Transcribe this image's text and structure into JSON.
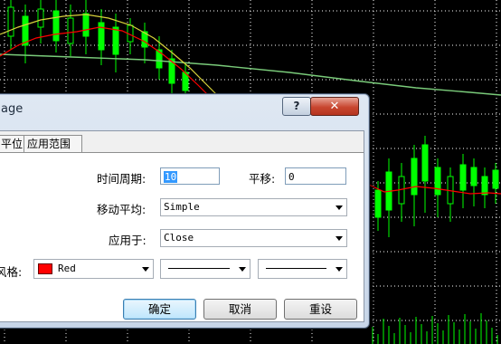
{
  "dialog": {
    "title": "age",
    "help_label": "?",
    "close_label": "✕",
    "tabs": [
      {
        "label": "平位"
      },
      {
        "label": "应用范围"
      }
    ],
    "params": {
      "period_label": "时间周期:",
      "period_value": "10",
      "shift_label": "平移:",
      "shift_value": "0",
      "method_label": "移动平均:",
      "method_value": "Simple",
      "apply_label": "应用于:",
      "apply_value": "Close",
      "style_label": "风格:",
      "color_value": "Red"
    },
    "buttons": {
      "ok": "确定",
      "cancel": "取消",
      "reset": "重设"
    }
  },
  "colors": {
    "background": "#000000",
    "grid": "#ffffff",
    "candle": "#00ff00",
    "ma_red": "#ff0000",
    "ma_yellow": "#d8d23a",
    "ma_green": "#7acb7a",
    "swatch": "#ff0000"
  }
}
